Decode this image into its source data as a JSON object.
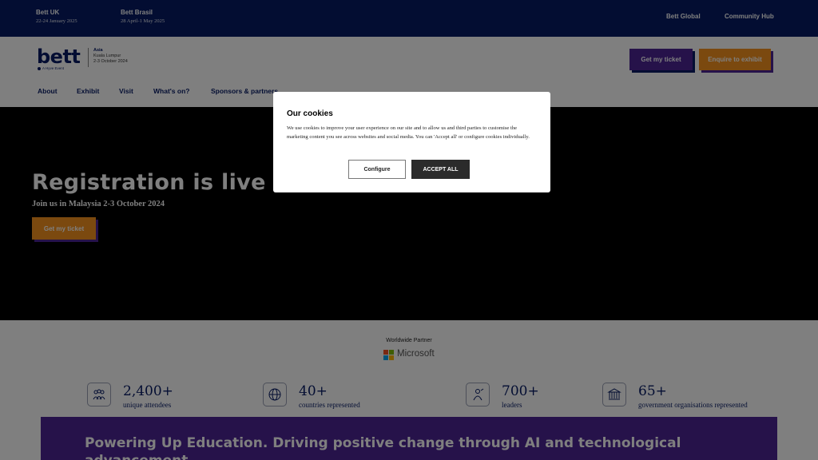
{
  "topbar": {
    "events": [
      {
        "name": "Bett UK",
        "date": "22-24 January 2025"
      },
      {
        "name": "Bett Brasil",
        "date": "28 April-1 May 2025"
      }
    ],
    "links": [
      "Bett Global",
      "Community Hub"
    ],
    "bg_color": "#061b65"
  },
  "header": {
    "logo": {
      "word": "bett",
      "tagline": "A Hyve Event",
      "region": "Asia",
      "city": "Kuala Lumpur",
      "dates": "2-3 October 2024"
    },
    "buttons": {
      "ticket": "Get my ticket",
      "exhibit": "Enquire to exhibit"
    },
    "nav": [
      "About",
      "Exhibit",
      "Visit",
      "What's on?",
      "Sponsors & partners"
    ]
  },
  "hero": {
    "title": "Registration is live",
    "subtitle": "Join us in Malaysia 2-3 October 2024",
    "button": "Get my ticket"
  },
  "partner": {
    "label": "Worldwide Partner",
    "name": "Microsoft",
    "icon": "microsoft-logo-icon"
  },
  "stats": [
    {
      "value": "2,400+",
      "label": "unique attendees",
      "icon": "crowd-icon"
    },
    {
      "value": "40+",
      "label": "countries represented",
      "icon": "globe-icon"
    },
    {
      "value": "700+",
      "label": "leaders",
      "icon": "leader-icon"
    },
    {
      "value": "65+",
      "label": "government organisations represented",
      "icon": "government-building-icon"
    }
  ],
  "banner": {
    "text": "Powering Up Education. Driving positive change through AI and technological advancement"
  },
  "cookie": {
    "title": "Our cookies",
    "text": "We use cookies to improve your user experience on our site and to allow us and third parties to customise the marketing content you see across websites and social media. You can 'Accept all' or configure cookies individually.",
    "configure": "Configure",
    "accept": "ACCEPT ALL"
  },
  "colors": {
    "navy": "#061b65",
    "purple": "#4c2594",
    "orange": "#f7931e"
  }
}
